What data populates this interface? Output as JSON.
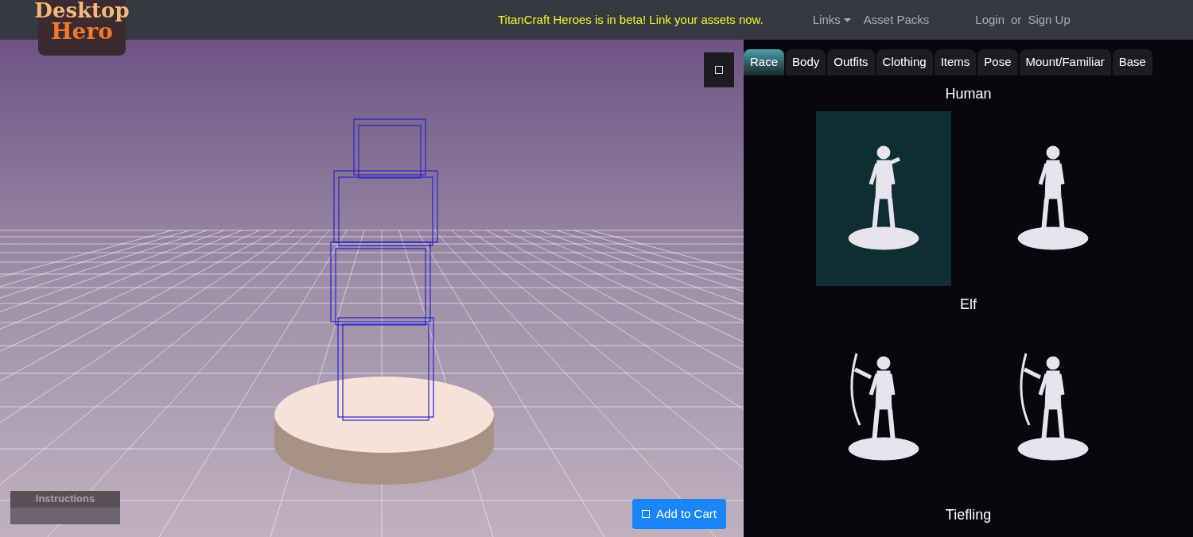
{
  "header": {
    "logo": [
      "Desktop",
      "Hero"
    ],
    "announcement": "TitanCraft Heroes is in beta! Link your assets now.",
    "nav": [
      {
        "label": "Links",
        "kind": "dropdown"
      },
      {
        "label": "Asset Packs",
        "kind": "link"
      }
    ],
    "auth": {
      "login": "Login",
      "separator": "or",
      "signup": "Sign Up"
    }
  },
  "viewport": {
    "instructions": "Instructions",
    "add_to_cart": "Add to Cart"
  },
  "tabs": [
    {
      "label": "Race",
      "selected": true
    },
    {
      "label": "Body",
      "selected": false
    },
    {
      "label": "Outfits",
      "selected": false
    },
    {
      "label": "Clothing",
      "selected": false
    },
    {
      "label": "Items",
      "selected": false
    },
    {
      "label": "Pose",
      "selected": false
    },
    {
      "label": "Mount/Familiar",
      "selected": false
    },
    {
      "label": "Base",
      "selected": false
    }
  ],
  "races": [
    {
      "name": "Human",
      "options": [
        {
          "selected": true,
          "kind": "reaching"
        },
        {
          "selected": false,
          "kind": "standing"
        }
      ]
    },
    {
      "name": "Elf",
      "options": [
        {
          "selected": false,
          "kind": "archer"
        },
        {
          "selected": false,
          "kind": "archer"
        }
      ]
    },
    {
      "name": "Tiefling"
    }
  ]
}
